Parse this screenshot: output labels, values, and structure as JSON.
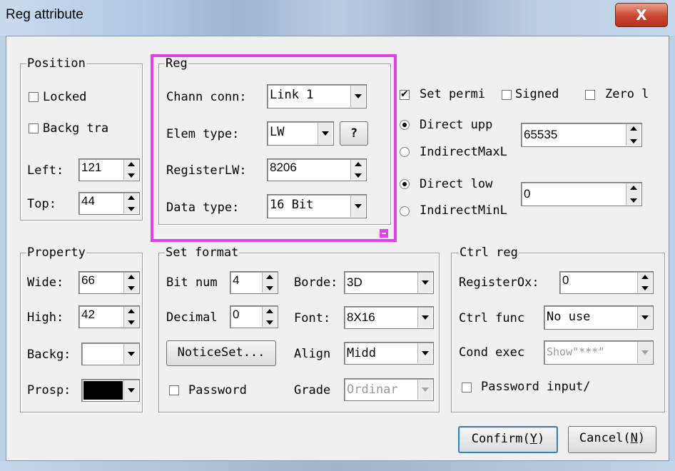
{
  "window": {
    "title": "Reg attribute",
    "close_glyph": "X"
  },
  "position": {
    "legend": "Position",
    "locked": "Locked",
    "locked_checked": false,
    "backg_tra": "Backg tra",
    "backg_tra_checked": false,
    "left_label": "Left:",
    "left_value": "121",
    "top_label": "Top:",
    "top_value": "44"
  },
  "reg": {
    "legend": "Reg",
    "chann_conn_label": "Chann conn:",
    "chann_conn_value": "Link 1",
    "elem_type_label": "Elem type:",
    "elem_type_value": "LW",
    "help_label": "?",
    "register_label": "RegisterLW:",
    "register_value": "8206",
    "data_type_label": "Data type:",
    "data_type_value": "16 Bit",
    "highlight_color": "#e540e5"
  },
  "limits": {
    "set_permi": "Set permi",
    "set_permi_checked": true,
    "signed": "Signed",
    "signed_checked": false,
    "zero": "Zero l",
    "zero_checked": false,
    "direct_upper": "Direct upp",
    "direct_upper_selected": true,
    "indirect_max": "IndirectMaxL",
    "upper_value": "65535",
    "direct_lower": "Direct low",
    "direct_lower_selected": true,
    "indirect_min": "IndirectMinL",
    "lower_value": "0"
  },
  "property": {
    "legend": "Property",
    "wide_label": "Wide:",
    "wide_value": "66",
    "high_label": "High:",
    "high_value": "42",
    "backg_label": "Backg:",
    "backg_color": "#ffffff",
    "prosp_label": "Prosp:",
    "prosp_color": "#000000"
  },
  "set_format": {
    "legend": "Set format",
    "bit_num_label": "Bit num",
    "bit_num_value": "4",
    "decimal_label": "Decimal",
    "decimal_value": "0",
    "notice_button": "NoticeSet...",
    "password_label": "Password",
    "password_checked": false,
    "border_label": "Borde:",
    "border_value": "3D",
    "font_label": "Font:",
    "font_value": "8X16",
    "align_label": "Align",
    "align_value": "Midd",
    "grade_label": "Grade",
    "grade_value": "Ordinar"
  },
  "ctrl_reg": {
    "legend": "Ctrl reg",
    "register_label": "RegisterOx:",
    "register_value": "0",
    "ctrl_func_label": "Ctrl func",
    "ctrl_func_value": "No use",
    "cond_exec_label": "Cond exec",
    "cond_exec_value": "Show\"***\"",
    "password_input_label": "Password input/",
    "password_input_checked": false
  },
  "buttons": {
    "confirm_text": "Confirm(",
    "confirm_key": "Y",
    "confirm_end": ")",
    "cancel_text": "Cancel(",
    "cancel_key": "N",
    "cancel_end": ")"
  }
}
